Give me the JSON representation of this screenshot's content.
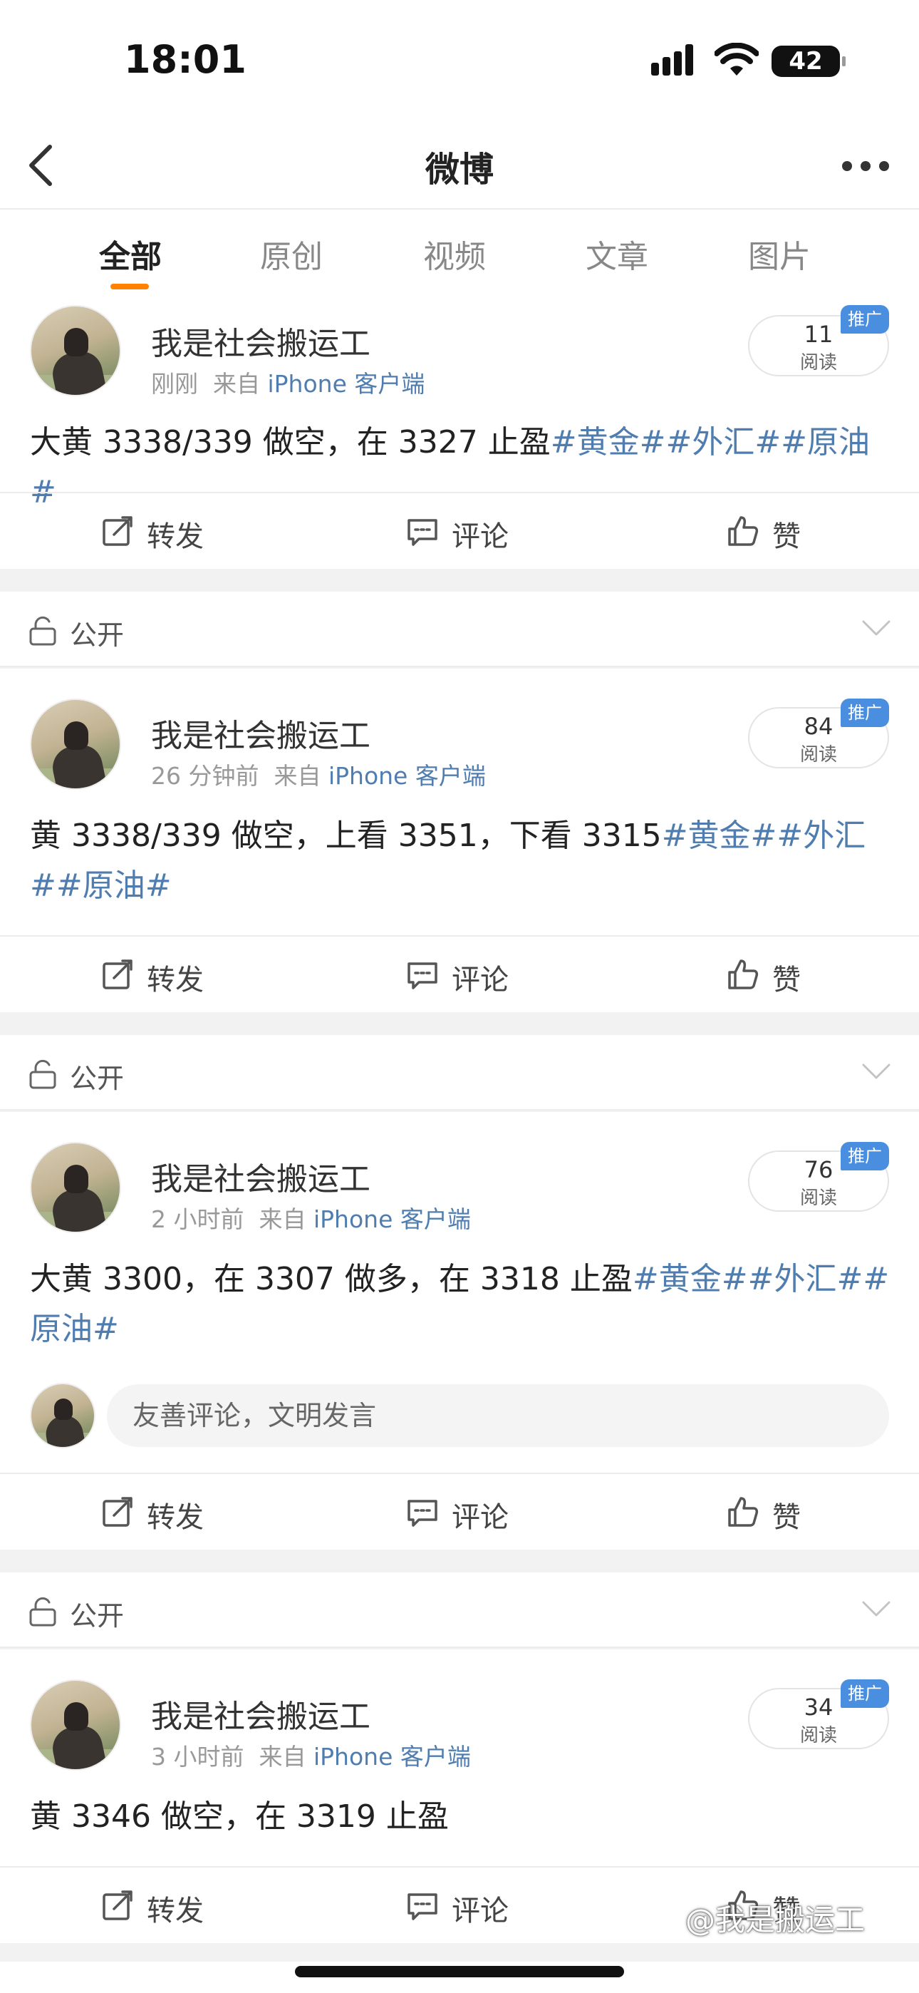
{
  "status_bar": {
    "time": "18:01",
    "battery": "42"
  },
  "nav": {
    "title": "微博"
  },
  "tabs": [
    {
      "label": "全部",
      "active": true
    },
    {
      "label": "原创"
    },
    {
      "label": "视频"
    },
    {
      "label": "文章"
    },
    {
      "label": "图片"
    }
  ],
  "visibility_label": "公开",
  "actions": {
    "repost": "转发",
    "comment": "评论",
    "like": "赞"
  },
  "comment_placeholder": "友善评论，文明发言",
  "posts": [
    {
      "username": "我是社会搬运工",
      "time": "刚刚",
      "from_prefix": "来自",
      "source": "iPhone 客户端",
      "read_count": "11",
      "read_label": "阅读",
      "promo": "推广",
      "text": "大黄 3338/339 做空，在 3327 止盈",
      "tags": "#黄金##外汇##原油#"
    },
    {
      "username": "我是社会搬运工",
      "time": "26 分钟前",
      "from_prefix": "来自",
      "source": "iPhone 客户端",
      "read_count": "84",
      "read_label": "阅读",
      "promo": "推广",
      "text": "黄 3338/339 做空，上看 3351，下看 3315",
      "tags": "#黄金##外汇##原油#"
    },
    {
      "username": "我是社会搬运工",
      "time": "2 小时前",
      "from_prefix": "来自",
      "source": "iPhone 客户端",
      "read_count": "76",
      "read_label": "阅读",
      "promo": "推广",
      "text": "大黄 3300，在 3307 做多，在 3318 止盈",
      "tags": "#黄金##外汇##原油#"
    },
    {
      "username": "我是社会搬运工",
      "time": "3 小时前",
      "from_prefix": "来自",
      "source": "iPhone 客户端",
      "read_count": "34",
      "read_label": "阅读",
      "promo": "推广",
      "text": "黄 3346 做空，在 3319 止盈",
      "tags": ""
    }
  ],
  "watermark": "@我是搬运工",
  "colors": {
    "accent": "#ff8200",
    "link": "#507daf",
    "promo": "#4a8ee0"
  }
}
